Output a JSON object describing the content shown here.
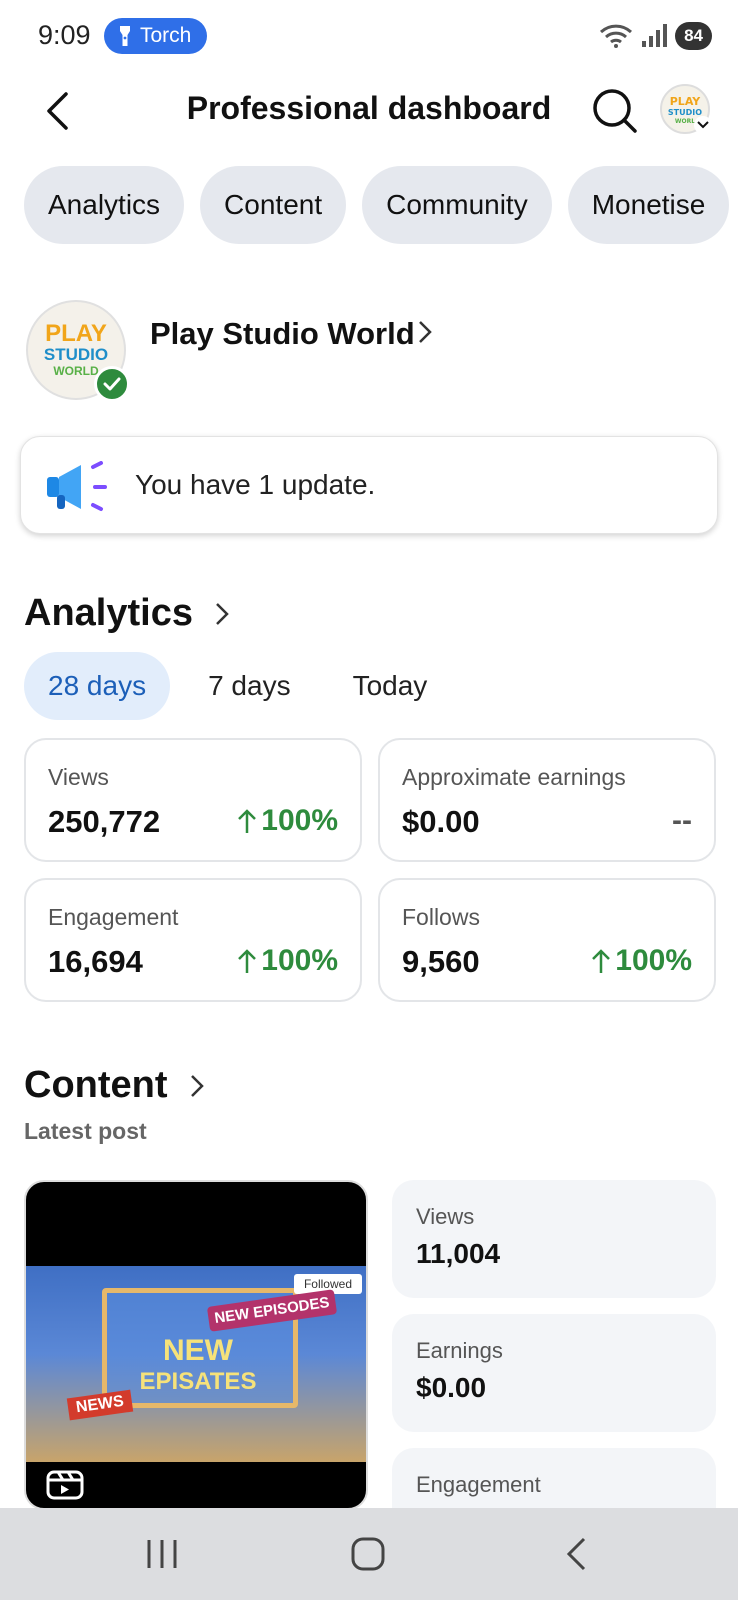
{
  "status_bar": {
    "time": "9:09",
    "torch_label": "Torch",
    "battery": "84"
  },
  "header": {
    "title": "Professional dashboard",
    "avatar_text": "PLAY STUDIO WORLD"
  },
  "tabs": [
    "Analytics",
    "Content",
    "Community",
    "Monetise"
  ],
  "profile": {
    "name": "Play Studio World",
    "logo_line1": "PLAY",
    "logo_line2": "STUDIO",
    "logo_line3": "WORLD"
  },
  "update": {
    "text": "You have 1 update."
  },
  "analytics": {
    "title": "Analytics",
    "ranges": [
      "28 days",
      "7 days",
      "Today"
    ],
    "active_range": "28 days",
    "metrics": [
      {
        "label": "Views",
        "value": "250,772",
        "change": "100%"
      },
      {
        "label": "Approximate earnings",
        "value": "$0.00",
        "change": "--"
      },
      {
        "label": "Engagement",
        "value": "16,694",
        "change": "100%"
      },
      {
        "label": "Follows",
        "value": "9,560",
        "change": "100%"
      }
    ]
  },
  "content": {
    "title": "Content",
    "subtitle": "Latest post",
    "post": {
      "title_line1": "NEW",
      "title_line2": "EPISATES",
      "followed_tag": "Followed",
      "new_episodes_tag": "NEW EPISODES",
      "news_tag": "NEWS"
    },
    "stats": [
      {
        "label": "Views",
        "value": "11,004"
      },
      {
        "label": "Earnings",
        "value": "$0.00"
      },
      {
        "label": "Engagement",
        "value": ""
      }
    ]
  },
  "colors": {
    "accent_blue": "#2f6fe8",
    "positive_green": "#2e8b3d",
    "active_range_bg": "#e2edfb",
    "active_range_text": "#1c5fb8",
    "chip_bg": "#e5e8ee"
  }
}
